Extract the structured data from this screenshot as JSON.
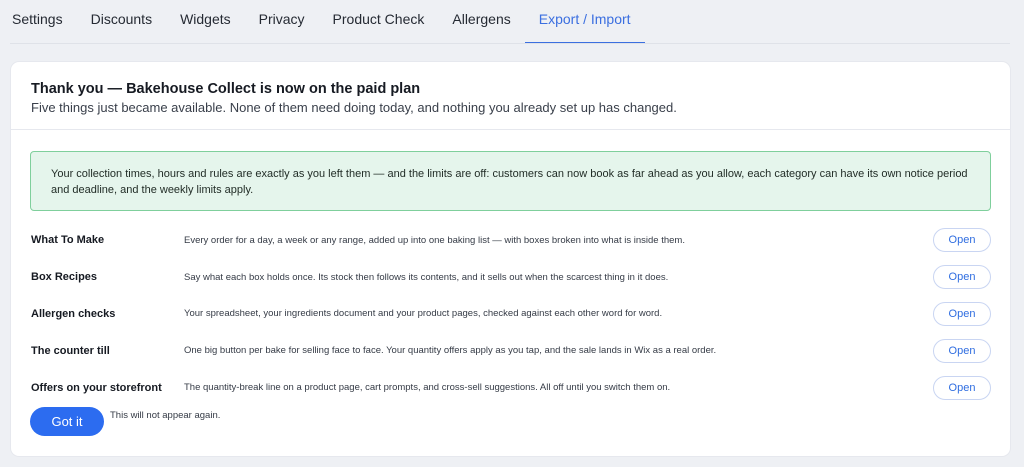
{
  "tabs": [
    {
      "label": "Settings",
      "active": false
    },
    {
      "label": "Discounts",
      "active": false
    },
    {
      "label": "Widgets",
      "active": false
    },
    {
      "label": "Privacy",
      "active": false
    },
    {
      "label": "Product Check",
      "active": false
    },
    {
      "label": "Allergens",
      "active": false
    },
    {
      "label": "Export / Import",
      "active": true
    }
  ],
  "card": {
    "title": "Thank you — Bakehouse Collect is now on the paid plan",
    "subtitle": "Five things just became available. None of them need doing today, and nothing you already set up has changed.",
    "notice": "Your collection times, hours and rules are exactly as you left them — and the limits are off: customers can now book as far ahead as you allow, each category can have its own notice period and deadline, and the weekly limits apply.",
    "features": [
      {
        "name": "What To Make",
        "description": "Every order for a day, a week or any range, added up into one baking list — with boxes broken into what is inside them.",
        "action": "Open"
      },
      {
        "name": "Box Recipes",
        "description": "Say what each box holds once. Its stock then follows its contents, and it sells out when the scarcest thing in it does.",
        "action": "Open"
      },
      {
        "name": "Allergen checks",
        "description": "Your spreadsheet, your ingredients document and your product pages, checked against each other word for word.",
        "action": "Open"
      },
      {
        "name": "The counter till",
        "description": "One big button per bake for selling face to face. Your quantity offers apply as you tap, and the sale lands in Wix as a real order.",
        "action": "Open"
      },
      {
        "name": "Offers on your storefront",
        "description": "The quantity-break line on a product page, cart prompts, and cross-sell suggestions. All off until you switch them on.",
        "action": "Open"
      }
    ],
    "dismiss_label": "Got it",
    "dismiss_note": "This will not appear again."
  },
  "colors": {
    "accent": "#2c6cf0",
    "active_tab": "#3b6fe0",
    "notice_bg": "#e5f5ec",
    "notice_border": "#7fcf9c",
    "page_bg": "#eef0f4"
  }
}
